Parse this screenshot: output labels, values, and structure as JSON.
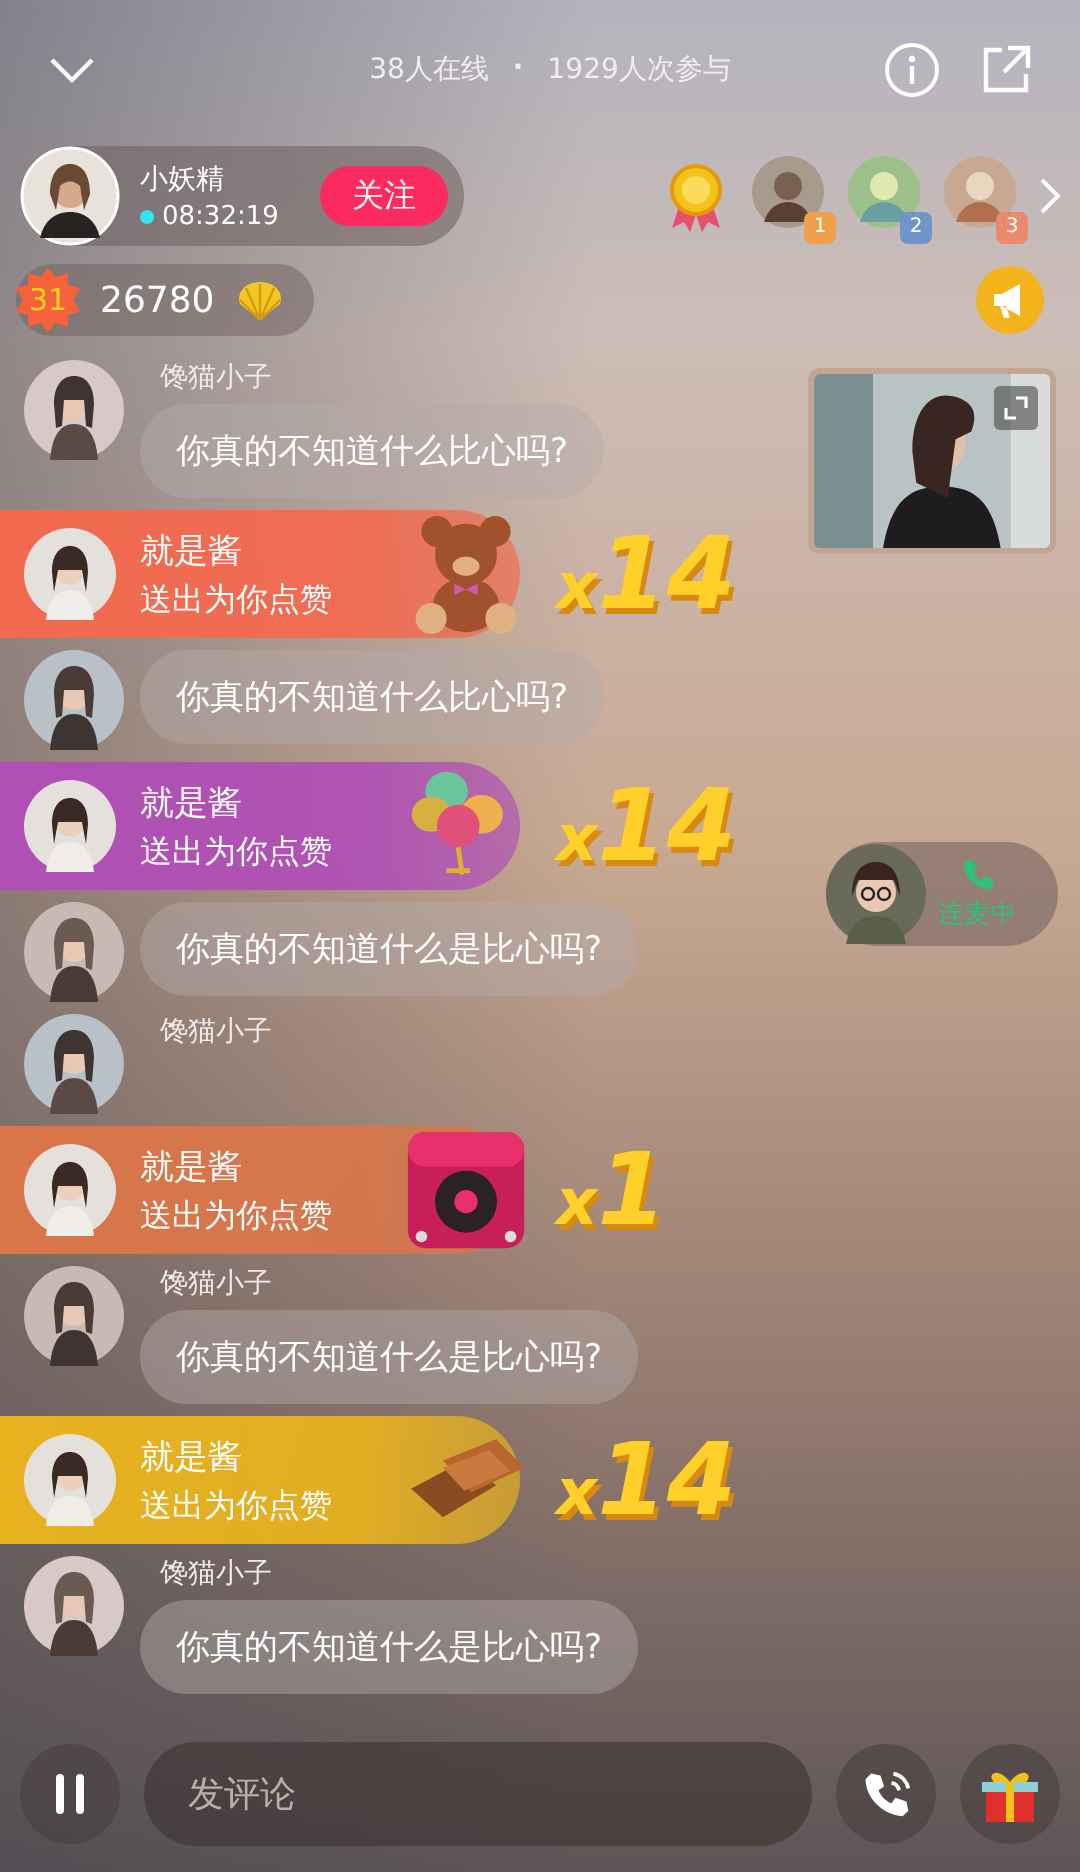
{
  "header": {
    "online": "38人在线",
    "separator": "·",
    "participation": "1929人次参与"
  },
  "host": {
    "name": "小妖精",
    "live_time": "08:32:19",
    "follow_label": "关注"
  },
  "leaderboard": {
    "ranks": [
      {
        "rank": "1",
        "color": "#f0a04b"
      },
      {
        "rank": "2",
        "color": "#6f95c9"
      },
      {
        "rank": "3",
        "color": "#e98a6c"
      }
    ]
  },
  "coins": {
    "badge": "31",
    "amount": "26780"
  },
  "call": {
    "status": "连麦中"
  },
  "chat": [
    {
      "kind": "message",
      "name": "馋猫小子",
      "text": "你真的不知道什么比心吗?"
    },
    {
      "kind": "gift",
      "sender": "就是酱",
      "action": "送出为你点赞",
      "count": "x14",
      "color": "#f26a4f"
    },
    {
      "kind": "message",
      "text": "你真的不知道什么比心吗?"
    },
    {
      "kind": "gift",
      "sender": "就是酱",
      "action": "送出为你点赞",
      "count": "x14",
      "color": "#b04fb5"
    },
    {
      "kind": "message",
      "text": "你真的不知道什么是比心吗?"
    },
    {
      "kind": "message",
      "name": "馋猫小子"
    },
    {
      "kind": "gift",
      "sender": "就是酱",
      "action": "送出为你点赞",
      "count": "x1",
      "color": "#d9764a"
    },
    {
      "kind": "message",
      "name": "馋猫小子",
      "text": "你真的不知道什么是比心吗?"
    },
    {
      "kind": "gift",
      "sender": "就是酱",
      "action": "送出为你点赞",
      "count": "x14",
      "color": "#e8b21f"
    },
    {
      "kind": "message",
      "name": "馋猫小子",
      "text": "你真的不知道什么是比心吗?"
    }
  ],
  "input": {
    "placeholder": "发评论"
  }
}
